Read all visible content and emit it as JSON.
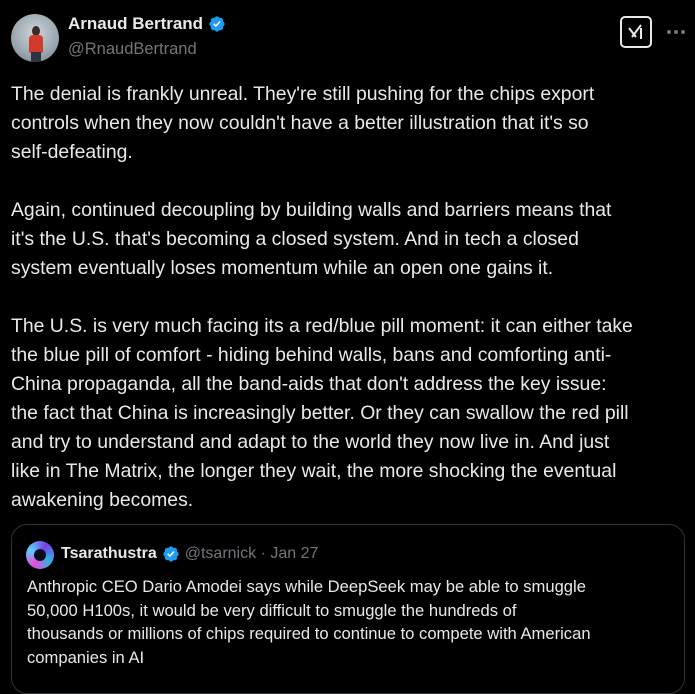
{
  "author": {
    "display_name": "Arnaud Bertrand",
    "handle": "@RnaudBertrand"
  },
  "tweet": {
    "paragraphs": [
      "The denial is frankly unreal. They're still pushing for the chips export\ncontrols when they now couldn't have a better illustration that it's so\nself-defeating.",
      "Again, continued decoupling by building walls and barriers means that\nit's the U.S. that's becoming a closed system. And in tech a closed\nsystem eventually loses momentum while an open one gains it.",
      "The U.S. is very much facing its a red/blue pill moment: it can either take\nthe blue pill of comfort - hiding behind walls, bans and comforting anti-\nChina propaganda, all the band-aids that don't address the key issue:\nthe fact that China is increasingly better. Or they can swallow the red pill\nand try to understand and adapt to the world they now live in. And just\nlike in The Matrix, the longer they wait, the more shocking the eventual\nawakening becomes."
    ]
  },
  "quote": {
    "display_name": "Tsarathustra",
    "meta": "@tsarnick · Jan 27",
    "text": "Anthropic CEO Dario Amodei says while DeepSeek may be able to smuggle\n50,000 H100s, it would be very difficult to smuggle the hundreds of\nthousands or millions of chips required to continue to compete with American\ncompanies in AI"
  },
  "icons": {
    "verified": "verified-badge-icon",
    "grok": "grok-icon",
    "more": "more-options-icon"
  },
  "colors": {
    "background": "#000000",
    "text": "#e7e9ea",
    "secondary": "#71767b",
    "verified": "#1d9bf0",
    "border": "#2f3336"
  }
}
